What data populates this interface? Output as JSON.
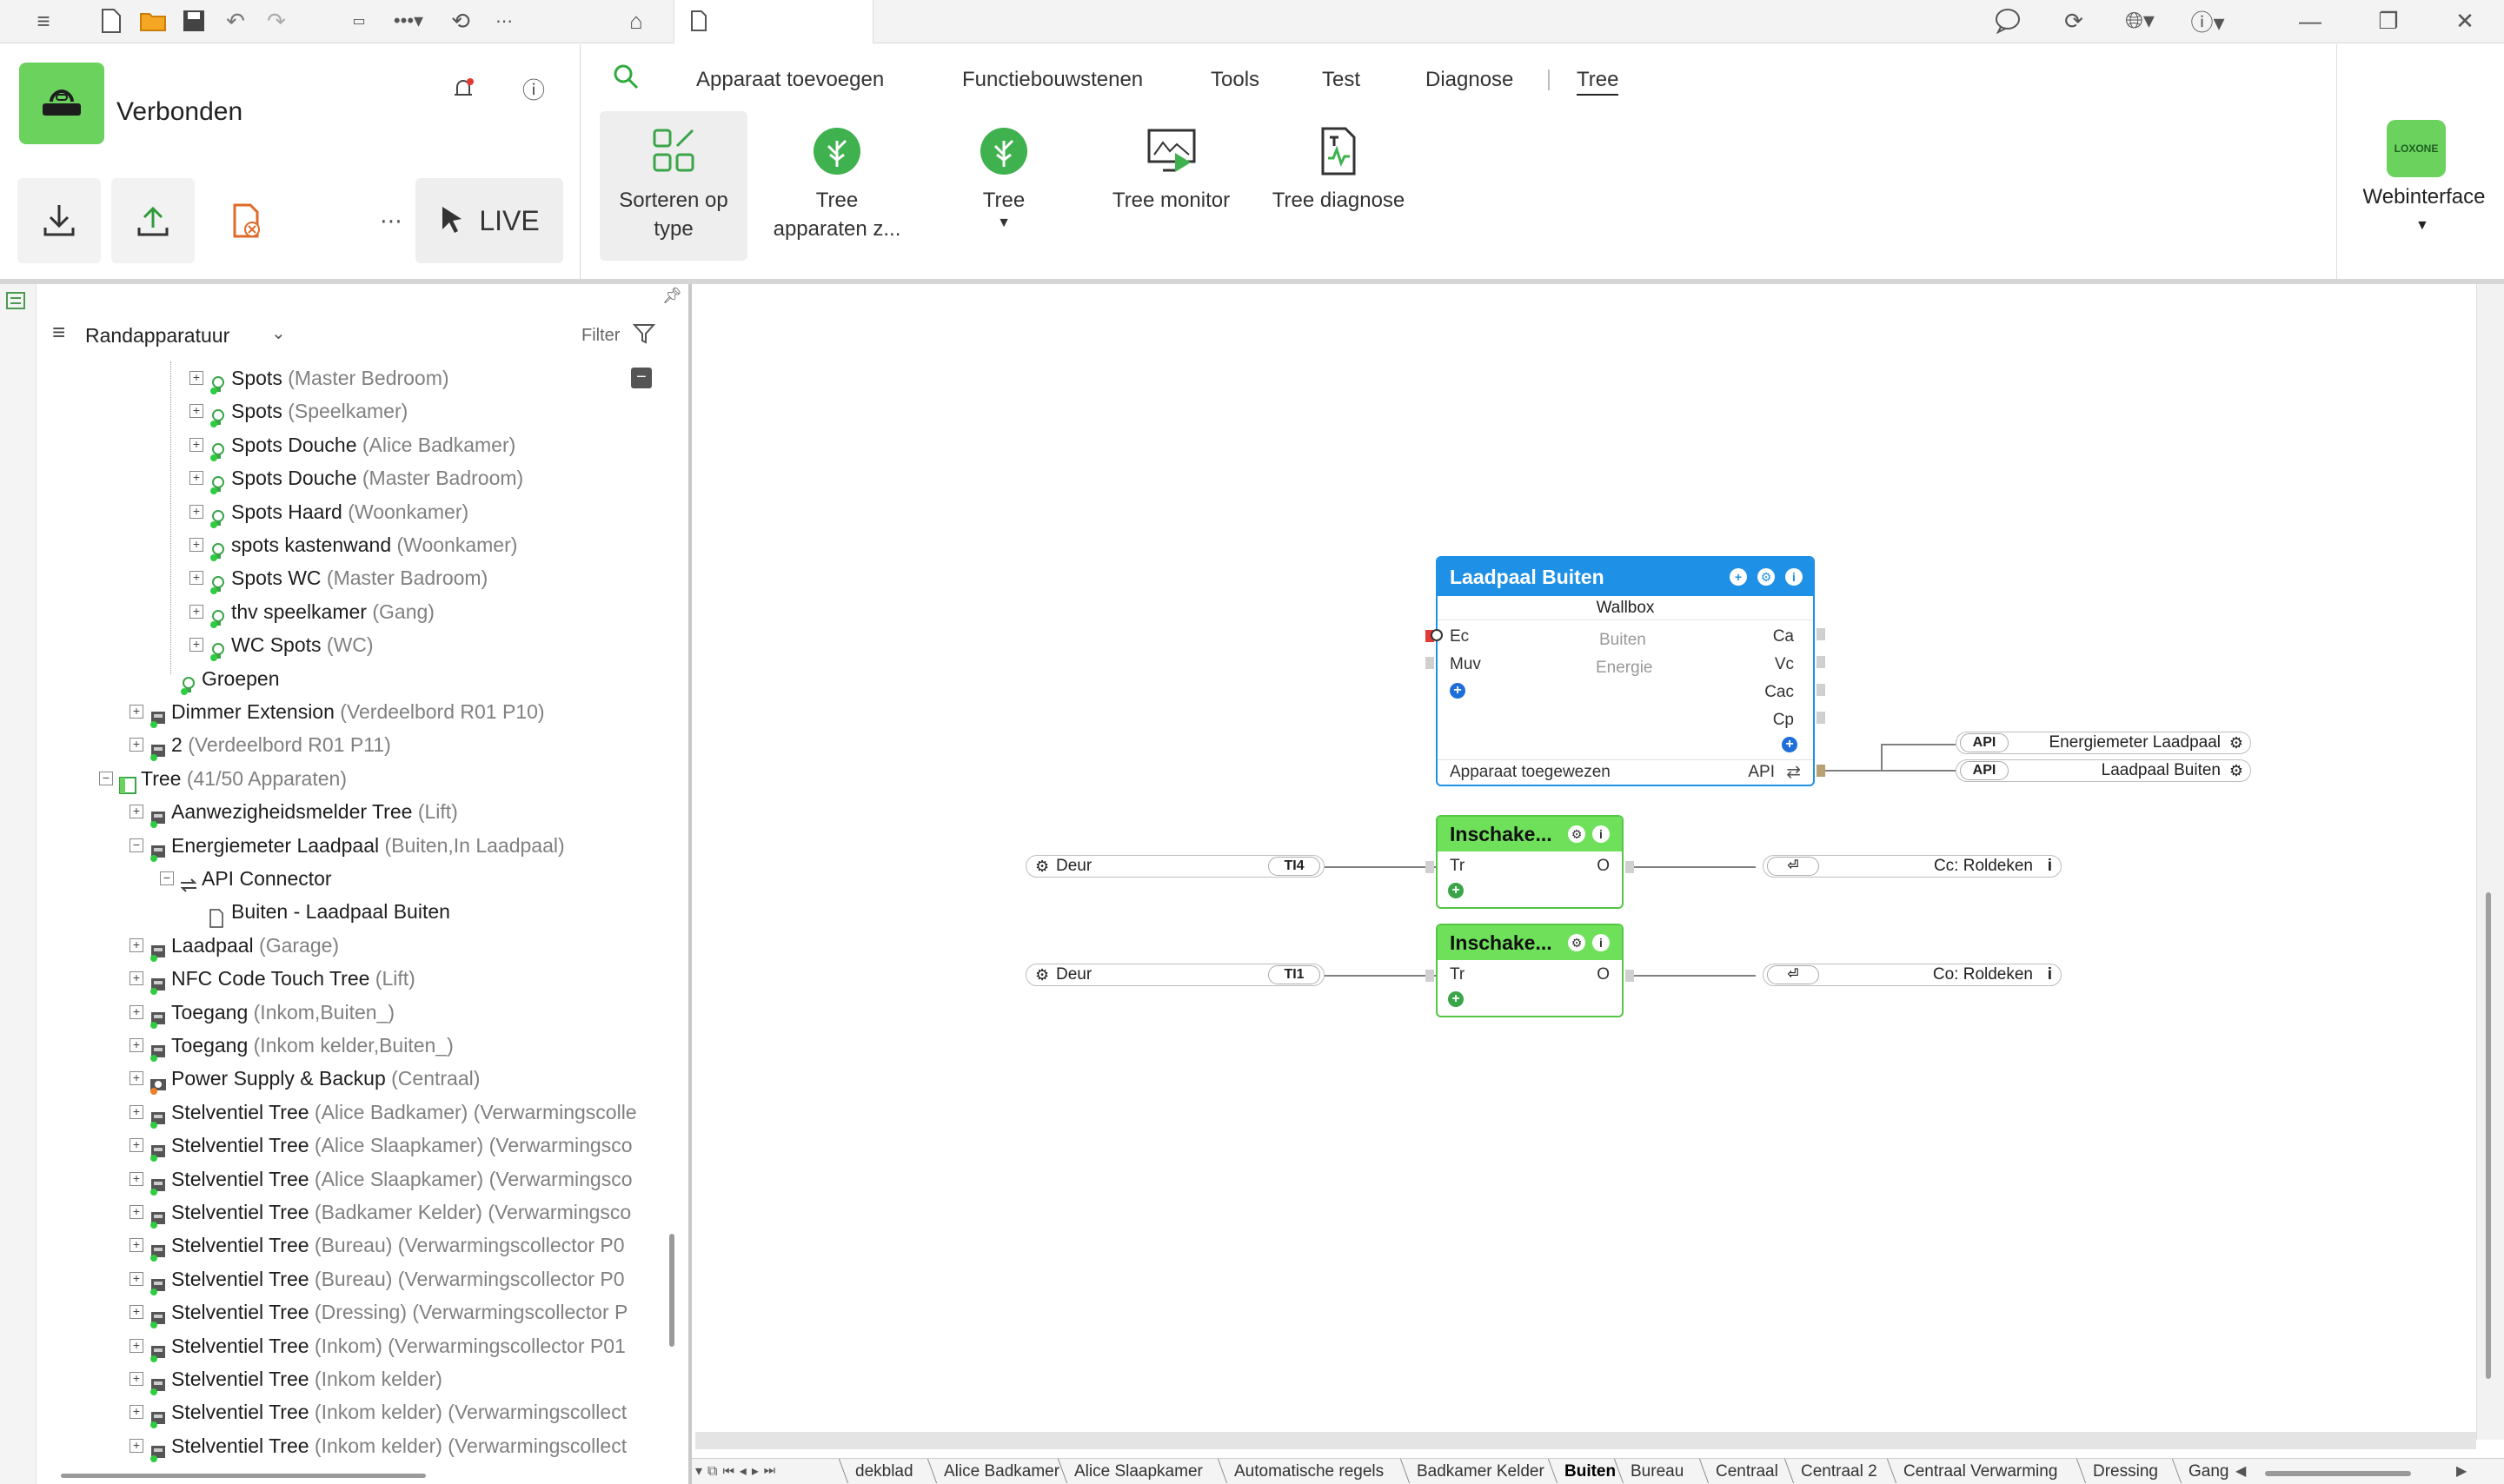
{
  "titlebar": {
    "menu_icon": "hamburger-icon",
    "tabs": [
      {
        "icon": "home-icon"
      },
      {
        "icon": "document-icon",
        "label": ""
      }
    ],
    "window_controls": [
      "minimize",
      "restore",
      "close"
    ]
  },
  "connection": {
    "status": "Verbonden",
    "live_label": "LIVE"
  },
  "menu": {
    "items": [
      "Apparaat toevoegen",
      "Functiebouwstenen",
      "Tools",
      "Test",
      "Diagnose",
      "Tree"
    ],
    "active": "Tree"
  },
  "ribbon": {
    "sort_line1": "Sorteren op",
    "sort_line2": "type",
    "tree_devices_line1": "Tree",
    "tree_devices_line2": "apparaten z...",
    "tree": "Tree",
    "tree_monitor": "Tree monitor",
    "tree_diagnose": "Tree diagnose",
    "webinterface": "Webinterface",
    "logo_text": "LOXONE"
  },
  "tree_panel": {
    "title": "Randapparatuur",
    "filter": "Filter",
    "rows": [
      {
        "name": "Spots",
        "sub": "(Master Bedroom)"
      },
      {
        "name": "Spots",
        "sub": "(Speelkamer)"
      },
      {
        "name": "Spots Douche",
        "sub": "(Alice Badkamer)"
      },
      {
        "name": "Spots Douche",
        "sub": "(Master Badroom)"
      },
      {
        "name": "Spots Haard",
        "sub": "(Woonkamer)"
      },
      {
        "name": "spots kastenwand",
        "sub": "(Woonkamer)"
      },
      {
        "name": "Spots WC",
        "sub": "(Master Badroom)"
      },
      {
        "name": "thv speelkamer",
        "sub": "(Gang)"
      },
      {
        "name": "WC Spots",
        "sub": "(WC)"
      },
      {
        "name": "Groepen",
        "sub": ""
      },
      {
        "name": "Dimmer Extension",
        "sub": "(Verdeelbord R01 P10)"
      },
      {
        "name": "2",
        "sub": "(Verdeelbord R01 P11)"
      },
      {
        "name": "Tree",
        "sub": "(41/50 Apparaten)"
      },
      {
        "name": "Aanwezigheidsmelder Tree",
        "sub": "(Lift)"
      },
      {
        "name": "Energiemeter Laadpaal",
        "sub": "(Buiten,In Laadpaal)"
      },
      {
        "name": "API Connector",
        "sub": ""
      },
      {
        "name": "Buiten - Laadpaal Buiten",
        "sub": ""
      },
      {
        "name": "Laadpaal",
        "sub": "(Garage)"
      },
      {
        "name": "NFC Code Touch Tree",
        "sub": "(Lift)"
      },
      {
        "name": "Toegang",
        "sub": "(Inkom,Buiten_)"
      },
      {
        "name": "Toegang",
        "sub": "(Inkom kelder,Buiten_)"
      },
      {
        "name": "Power Supply & Backup",
        "sub": "(Centraal)"
      },
      {
        "name": "Stelventiel Tree",
        "sub": "(Alice Badkamer) (Verwarmingscolle"
      },
      {
        "name": "Stelventiel Tree",
        "sub": "(Alice Slaapkamer) (Verwarmingsco"
      },
      {
        "name": "Stelventiel Tree",
        "sub": "(Alice Slaapkamer) (Verwarmingsco"
      },
      {
        "name": "Stelventiel Tree",
        "sub": "(Badkamer Kelder) (Verwarmingsco"
      },
      {
        "name": "Stelventiel Tree",
        "sub": "(Bureau) (Verwarmingscollector P0"
      },
      {
        "name": "Stelventiel Tree",
        "sub": "(Bureau) (Verwarmingscollector P0"
      },
      {
        "name": "Stelventiel Tree",
        "sub": "(Dressing) (Verwarmingscollector P"
      },
      {
        "name": "Stelventiel Tree",
        "sub": "(Inkom) (Verwarmingscollector P01"
      },
      {
        "name": "Stelventiel Tree",
        "sub": "(Inkom kelder)"
      },
      {
        "name": "Stelventiel Tree",
        "sub": "(Inkom kelder) (Verwarmingscollect"
      },
      {
        "name": "Stelventiel Tree",
        "sub": "(Inkom kelder) (Verwarmingscollect"
      }
    ]
  },
  "blocks": {
    "wallbox": {
      "title": "Laadpaal Buiten",
      "type": "Wallbox",
      "inputs": [
        "Ec",
        "Muv"
      ],
      "outputs": [
        "Ca",
        "Vc",
        "Cac",
        "Cp"
      ],
      "center1": "Buiten",
      "center2": "Energie",
      "footer": "Apparaat toegewezen",
      "footer_right": "API",
      "color": "#1e90e6"
    },
    "switch1": {
      "title": "Inschake...",
      "input": "Tr",
      "output": "O",
      "color": "#6ee05a"
    },
    "switch2": {
      "title": "Inschake...",
      "input": "Tr",
      "output": "O",
      "color": "#6ee05a"
    },
    "api_refs": [
      {
        "tag": "API",
        "label": "Energiemeter Laadpaal"
      },
      {
        "tag": "API",
        "label": "Laadpaal Buiten"
      }
    ],
    "in_refs": [
      {
        "label": "Deur",
        "tag": "TI4"
      },
      {
        "label": "Deur",
        "tag": "TI1"
      }
    ],
    "out_refs": [
      {
        "label": "Cc: Roldeken"
      },
      {
        "label": "Co: Roldeken"
      }
    ]
  },
  "bottom_tabs": {
    "items": [
      "dekblad",
      "Alice Badkamer",
      "Alice Slaapkamer",
      "Automatische regels",
      "Badkamer Kelder",
      "Buiten",
      "Bureau",
      "Centraal",
      "Centraal 2",
      "Centraal Verwarming",
      "Dressing",
      "Gang"
    ],
    "active": "Buiten"
  }
}
